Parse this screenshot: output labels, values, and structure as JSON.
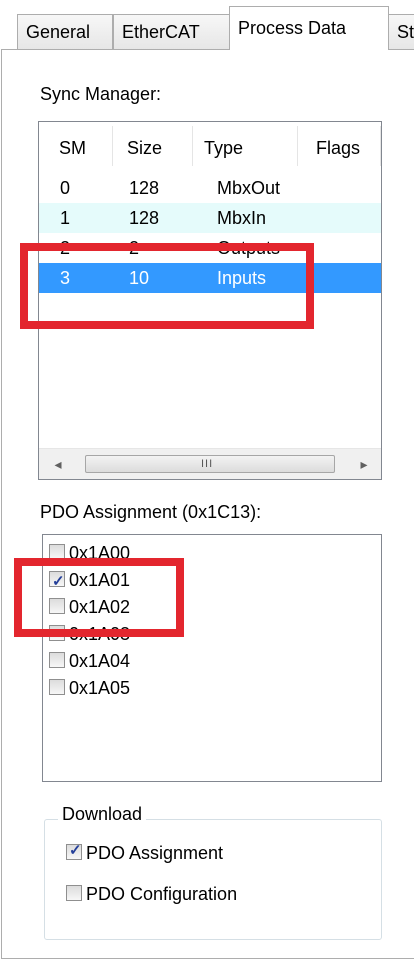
{
  "tabs": [
    "General",
    "EtherCAT",
    "Process Data",
    "Startup"
  ],
  "sync_manager": {
    "label": "Sync Manager:",
    "columns": [
      "SM",
      "Size",
      "Type",
      "Flags"
    ],
    "rows": [
      {
        "sm": "0",
        "size": "128",
        "type": "MbxOut",
        "flags": ""
      },
      {
        "sm": "1",
        "size": "128",
        "type": "MbxIn",
        "flags": ""
      },
      {
        "sm": "2",
        "size": "2",
        "type": "Outputs",
        "flags": ""
      },
      {
        "sm": "3",
        "size": "10",
        "type": "Inputs",
        "flags": ""
      }
    ],
    "selected_row": 3,
    "scroll": {
      "left_arrow": "◂",
      "right_arrow": "▸",
      "grip": "III"
    }
  },
  "pdo_assignment": {
    "label": "PDO Assignment (0x1C13):",
    "items": [
      {
        "label": "0x1A00",
        "checked": false
      },
      {
        "label": "0x1A01",
        "checked": true
      },
      {
        "label": "0x1A02",
        "checked": false
      },
      {
        "label": "0x1A03",
        "checked": false
      },
      {
        "label": "0x1A04",
        "checked": false
      },
      {
        "label": "0x1A05",
        "checked": false
      }
    ]
  },
  "download": {
    "label": "Download",
    "pdo_assignment": {
      "label": "PDO Assignment",
      "checked": true
    },
    "pdo_configuration": {
      "label": "PDO Configuration",
      "checked": false
    }
  },
  "colors": {
    "highlight": "#e3262e",
    "selection": "#3399ff",
    "hover_row": "#e5fbfb"
  }
}
